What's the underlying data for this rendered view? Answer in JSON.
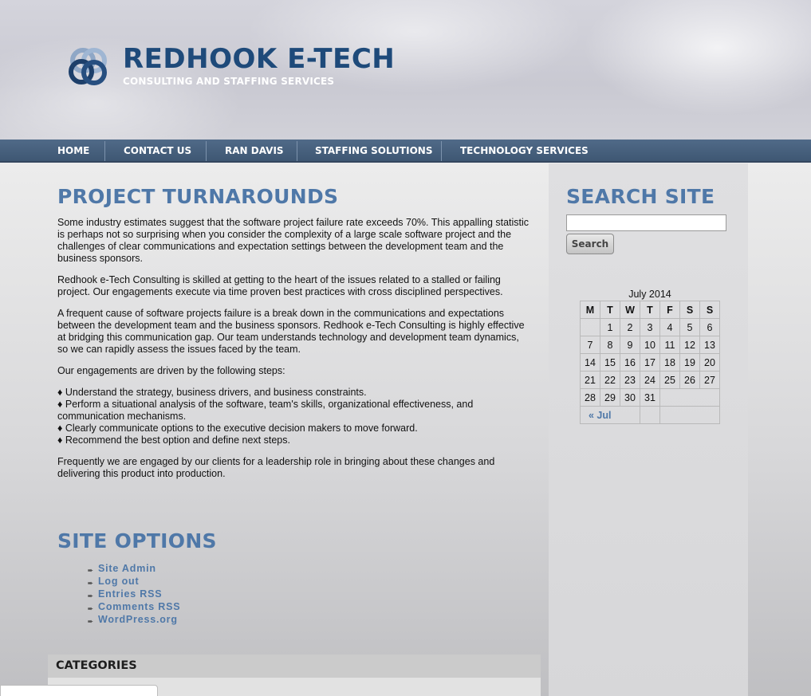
{
  "header": {
    "title": "REDHOOK E-TECH",
    "tagline": "CONSULTING AND STAFFING SERVICES",
    "logo_icon": "interlocking-rings-logo",
    "colors": {
      "title": "#1e4a7a",
      "accent": "#4f78a8",
      "nav_bg": "#46607e"
    }
  },
  "nav": {
    "items": [
      {
        "label": "HOME"
      },
      {
        "label": "CONTACT US"
      },
      {
        "label": "RAN DAVIS"
      },
      {
        "label": "STAFFING SOLUTIONS"
      },
      {
        "label": "TECHNOLOGY SERVICES"
      }
    ]
  },
  "main": {
    "title": "PROJECT TURNAROUNDS",
    "paragraphs": [
      "Some industry estimates suggest that the software project failure rate exceeds 70%. This appalling statistic is perhaps not so surprising when you consider the complexity of a large scale software project and the challenges of clear communications and expectation settings between the development team and the business sponsors.",
      "Redhook e-Tech Consulting is skilled at getting to the heart of the issues related to a stalled or failing project. Our engagements execute via time proven best practices with cross disciplined perspectives.",
      "A frequent cause of software projects failure is a break down in the communications and expectations between the development team and the business sponsors. Redhook e-Tech Consulting is highly effective at bridging this communication gap. Our team understands technology and development team dynamics, so we can rapidly assess the issues faced by the team.",
      "Our engagements are driven by the following steps:"
    ],
    "steps": [
      "♦ Understand the strategy, business drivers, and business constraints.",
      "♦ Perform a situational analysis of the software, team's skills, organizational effectiveness, and communication mechanisms.",
      "♦ Clearly communicate options to the executive decision makers to move forward.",
      "♦ Recommend the best option and define next steps."
    ],
    "closing": "Frequently we are engaged by our clients for a leadership role in bringing about these changes and delivering this product into production."
  },
  "site_options": {
    "title": "SITE OPTIONS",
    "links": [
      "Site Admin",
      "Log out",
      "Entries RSS",
      "Comments RSS",
      "WordPress.org"
    ]
  },
  "categories": {
    "title": "CATEGORIES"
  },
  "sidebar": {
    "search_title": "SEARCH SITE",
    "search_value": "",
    "search_button": "Search",
    "calendar": {
      "caption": "July 2014",
      "headers": [
        "M",
        "T",
        "W",
        "T",
        "F",
        "S",
        "S"
      ],
      "weeks": [
        [
          "",
          "1",
          "2",
          "3",
          "4",
          "5",
          "6"
        ],
        [
          "7",
          "8",
          "9",
          "10",
          "11",
          "12",
          "13"
        ],
        [
          "14",
          "15",
          "16",
          "17",
          "18",
          "19",
          "20"
        ],
        [
          "21",
          "22",
          "23",
          "24",
          "25",
          "26",
          "27"
        ],
        [
          "28",
          "29",
          "30",
          "31",
          "",
          "",
          ""
        ]
      ],
      "prev_link": "« Jul"
    }
  }
}
